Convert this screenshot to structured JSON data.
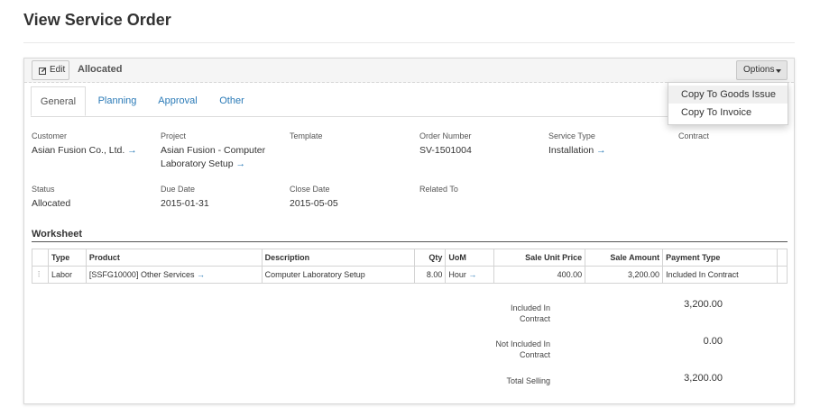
{
  "page": {
    "title": "View Service Order"
  },
  "toolbar": {
    "edit_label": "Edit",
    "status": "Allocated",
    "options_label": "Options"
  },
  "options_menu": {
    "items": [
      "Copy To Goods Issue",
      "Copy To Invoice"
    ]
  },
  "tabs": [
    "General",
    "Planning",
    "Approval",
    "Other"
  ],
  "fields": {
    "customer": {
      "label": "Customer",
      "value": "Asian Fusion Co., Ltd."
    },
    "project": {
      "label": "Project",
      "value_line1": "Asian Fusion - Computer",
      "value_line2": "Laboratory Setup"
    },
    "template": {
      "label": "Template",
      "value": ""
    },
    "order_number": {
      "label": "Order Number",
      "value": "SV-1501004"
    },
    "service_type": {
      "label": "Service Type",
      "value": "Installation"
    },
    "contract": {
      "label": "Contract",
      "value": ""
    },
    "status": {
      "label": "Status",
      "value": "Allocated"
    },
    "due_date": {
      "label": "Due Date",
      "value": "2015-01-31"
    },
    "close_date": {
      "label": "Close Date",
      "value": "2015-05-05"
    },
    "related_to": {
      "label": "Related To",
      "value": ""
    }
  },
  "worksheet": {
    "title": "Worksheet",
    "columns": [
      "Type",
      "Product",
      "Description",
      "Qty",
      "UoM",
      "Sale Unit Price",
      "Sale Amount",
      "Payment Type"
    ],
    "rows": [
      [
        "Labor",
        "[SSFG10000] Other Services",
        "Computer Laboratory Setup",
        "8.00",
        "Hour",
        "400.00",
        "3,200.00",
        "Included In Contract"
      ]
    ]
  },
  "summary": {
    "included": {
      "label_line1": "Included In",
      "label_line2": "Contract",
      "value": "3,200.00"
    },
    "not_included": {
      "label_line1": "Not Included In",
      "label_line2": "Contract",
      "value": "0.00"
    },
    "total": {
      "label": "Total Selling",
      "value": "3,200.00"
    }
  },
  "colors": {
    "link": "#2a7ab7",
    "panel_border": "#d9d9d9"
  },
  "icons": {
    "edit": "pencil-square-icon",
    "arrow": "arrow-right-icon",
    "caret": "caret-down-icon",
    "drag": "drag-handle-icon"
  }
}
